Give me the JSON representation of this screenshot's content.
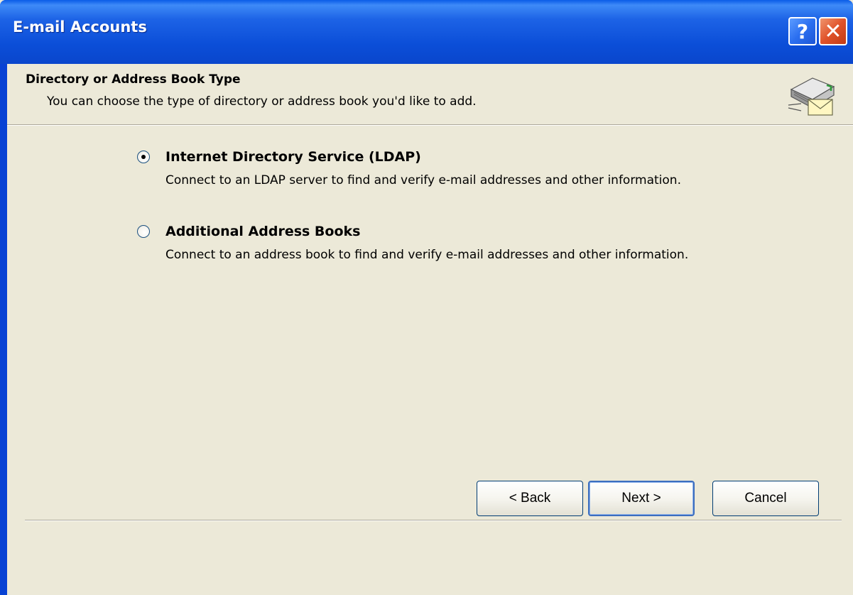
{
  "window": {
    "title": "E-mail Accounts",
    "help_glyph": "?",
    "close_glyph": "✕",
    "help_icon": "help-icon",
    "close_icon": "close-icon"
  },
  "header": {
    "title": "Directory or Address Book Type",
    "subtitle": "You can choose the type of directory or address book you'd like to add.",
    "icon": "address-book-icon"
  },
  "options": [
    {
      "label": "Internet Directory Service (LDAP)",
      "description": "Connect to an LDAP server to find and verify e-mail addresses and other information.",
      "selected": true
    },
    {
      "label": "Additional Address Books",
      "description": "Connect to an address book to find and verify e-mail addresses and other information.",
      "selected": false
    }
  ],
  "buttons": {
    "back": "< Back",
    "next": "Next >",
    "cancel": "Cancel"
  },
  "colors": {
    "titlebar": "#0b4ed8",
    "dialog_bg": "#ece9d8",
    "close_button": "#e0532a"
  }
}
